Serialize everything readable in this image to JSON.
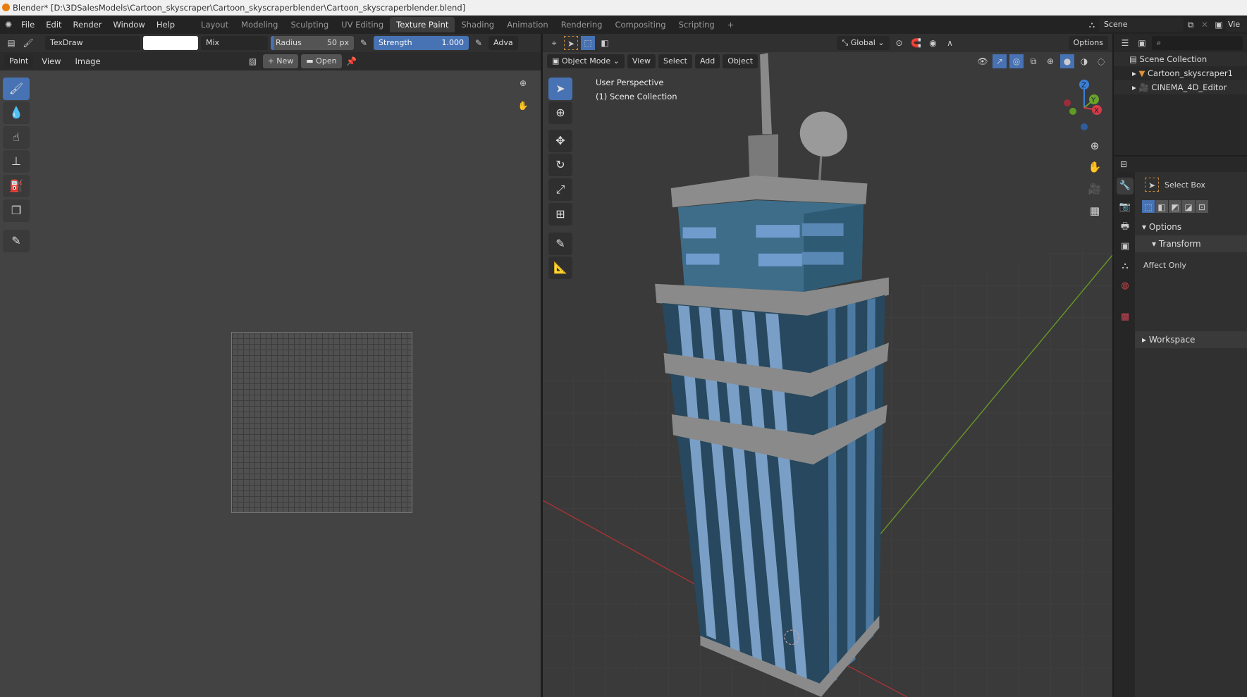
{
  "title": "Blender* [D:\\3DSalesModels\\Cartoon_skyscraper\\Cartoon_skyscraperblender\\Cartoon_skyscraperblender.blend]",
  "menu": [
    "File",
    "Edit",
    "Render",
    "Window",
    "Help"
  ],
  "workspaces": [
    "Layout",
    "Modeling",
    "Sculpting",
    "UV Editing",
    "Texture Paint",
    "Shading",
    "Animation",
    "Rendering",
    "Compositing",
    "Scripting"
  ],
  "active_workspace": "Texture Paint",
  "scene": "Scene",
  "view_layer": "Vie",
  "paint_header": {
    "brush": "TexDraw",
    "blend": "Mix",
    "radius_label": "Radius",
    "radius_value": "50 px",
    "strength_label": "Strength",
    "strength_value": "1.000",
    "advanced": "Adva"
  },
  "image_header": {
    "mode": "Paint",
    "view": "View",
    "image": "Image",
    "new": "New",
    "open": "Open"
  },
  "viewport_header": {
    "transform": "Global",
    "options": "Options",
    "mode": "Object Mode",
    "menus": [
      "View",
      "Select",
      "Add",
      "Object"
    ]
  },
  "viewport_overlay": {
    "perspective": "User Perspective",
    "collection": "(1) Scene Collection"
  },
  "gizmo": {
    "z": "Z",
    "y": "Y",
    "x": "X"
  },
  "outliner": {
    "root": "Scene Collection",
    "items": [
      "Cartoon_skyscraper1",
      "CINEMA_4D_Editor"
    ]
  },
  "properties": {
    "tool": "Select Box",
    "options": "Options",
    "transform": "Transform",
    "affect_only": "Affect Only",
    "workspace": "Workspace"
  },
  "colors": {
    "accent": "#4772b3",
    "building": "#3f6f8c",
    "stripe": "#7a9fc7",
    "slab": "#8a8a8a"
  }
}
